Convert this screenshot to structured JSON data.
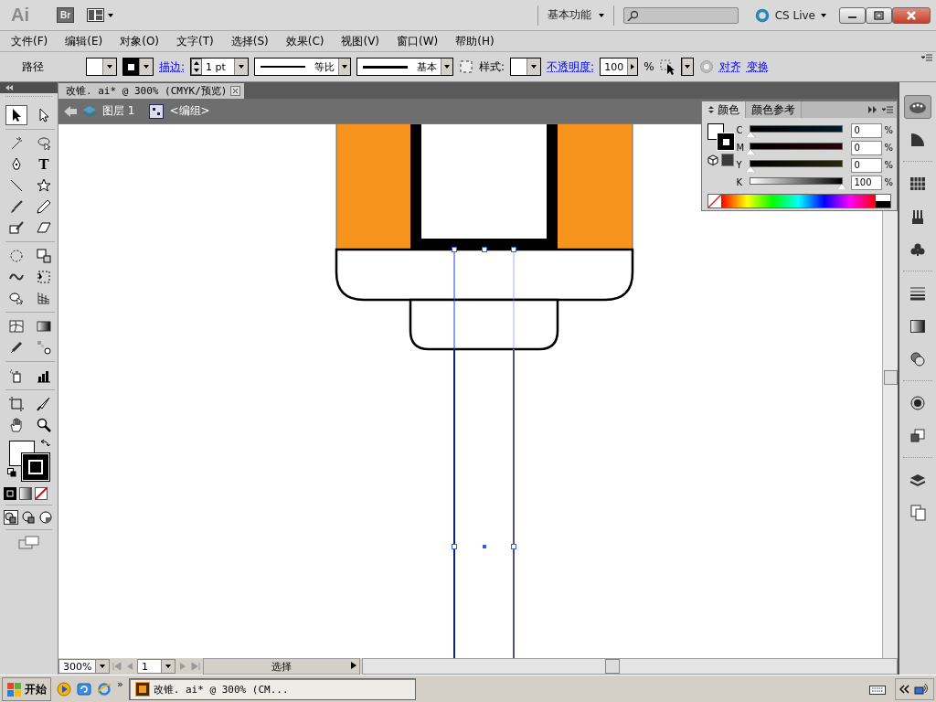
{
  "app_bar": {
    "logo": "Ai",
    "bridge": "Br",
    "workspace": "基本功能",
    "cs_live": "CS Live"
  },
  "menu": [
    "文件(F)",
    "编辑(E)",
    "对象(O)",
    "文字(T)",
    "选择(S)",
    "效果(C)",
    "视图(V)",
    "窗口(W)",
    "帮助(H)"
  ],
  "control_bar": {
    "selection": "路径",
    "stroke_label": "描边:",
    "stroke_weight": "1 pt",
    "profile": "等比",
    "brush": "基本",
    "style_label": "样式:",
    "opacity_label": "不透明度:",
    "opacity": "100",
    "percent": "%",
    "align": "对齐",
    "transform": "变换"
  },
  "document": {
    "tab": "改锥. ai* @ 300% (CMYK/预览)",
    "layer": "图层 1",
    "group": "<编组>",
    "zoom": "300%",
    "page": "1",
    "status": "选择"
  },
  "tools": [
    {
      "selected": true
    },
    {
      "selected": false
    },
    {
      "selected": false
    },
    {
      "selected": false
    },
    {
      "selected": false
    },
    {
      "selected": false,
      "glyph": "T"
    },
    {
      "selected": false
    },
    {
      "selected": false
    },
    {
      "selected": false
    },
    {
      "selected": false
    },
    {
      "selected": false
    },
    {
      "selected": false
    },
    {
      "selected": false
    },
    {
      "selected": false
    },
    {
      "selected": false
    },
    {
      "selected": false
    },
    {
      "selected": false
    },
    {
      "selected": false
    },
    {
      "selected": false
    },
    {
      "selected": false
    },
    {
      "selected": false
    },
    {
      "selected": false
    },
    {
      "selected": false
    },
    {
      "selected": false
    },
    {
      "selected": false
    },
    {
      "selected": false
    },
    {
      "selected": false
    },
    {
      "selected": false
    }
  ],
  "color_panel": {
    "tabs": [
      {
        "label": "颜色",
        "selected": true
      },
      {
        "label": "颜色参考",
        "selected": false
      }
    ],
    "channels": [
      {
        "name": "C",
        "level": 0,
        "value": "0",
        "unit": "%"
      },
      {
        "name": "M",
        "level": 0,
        "value": "0",
        "unit": "%"
      },
      {
        "name": "Y",
        "level": 0,
        "value": "0",
        "unit": "%"
      },
      {
        "name": "K",
        "level": 1,
        "value": "100",
        "unit": "%"
      }
    ]
  },
  "taskbar": {
    "start": "开始",
    "more": "»",
    "tasks": [
      {
        "label": "改锥. ai* @ 300% (CM...",
        "selected": true
      }
    ]
  }
}
